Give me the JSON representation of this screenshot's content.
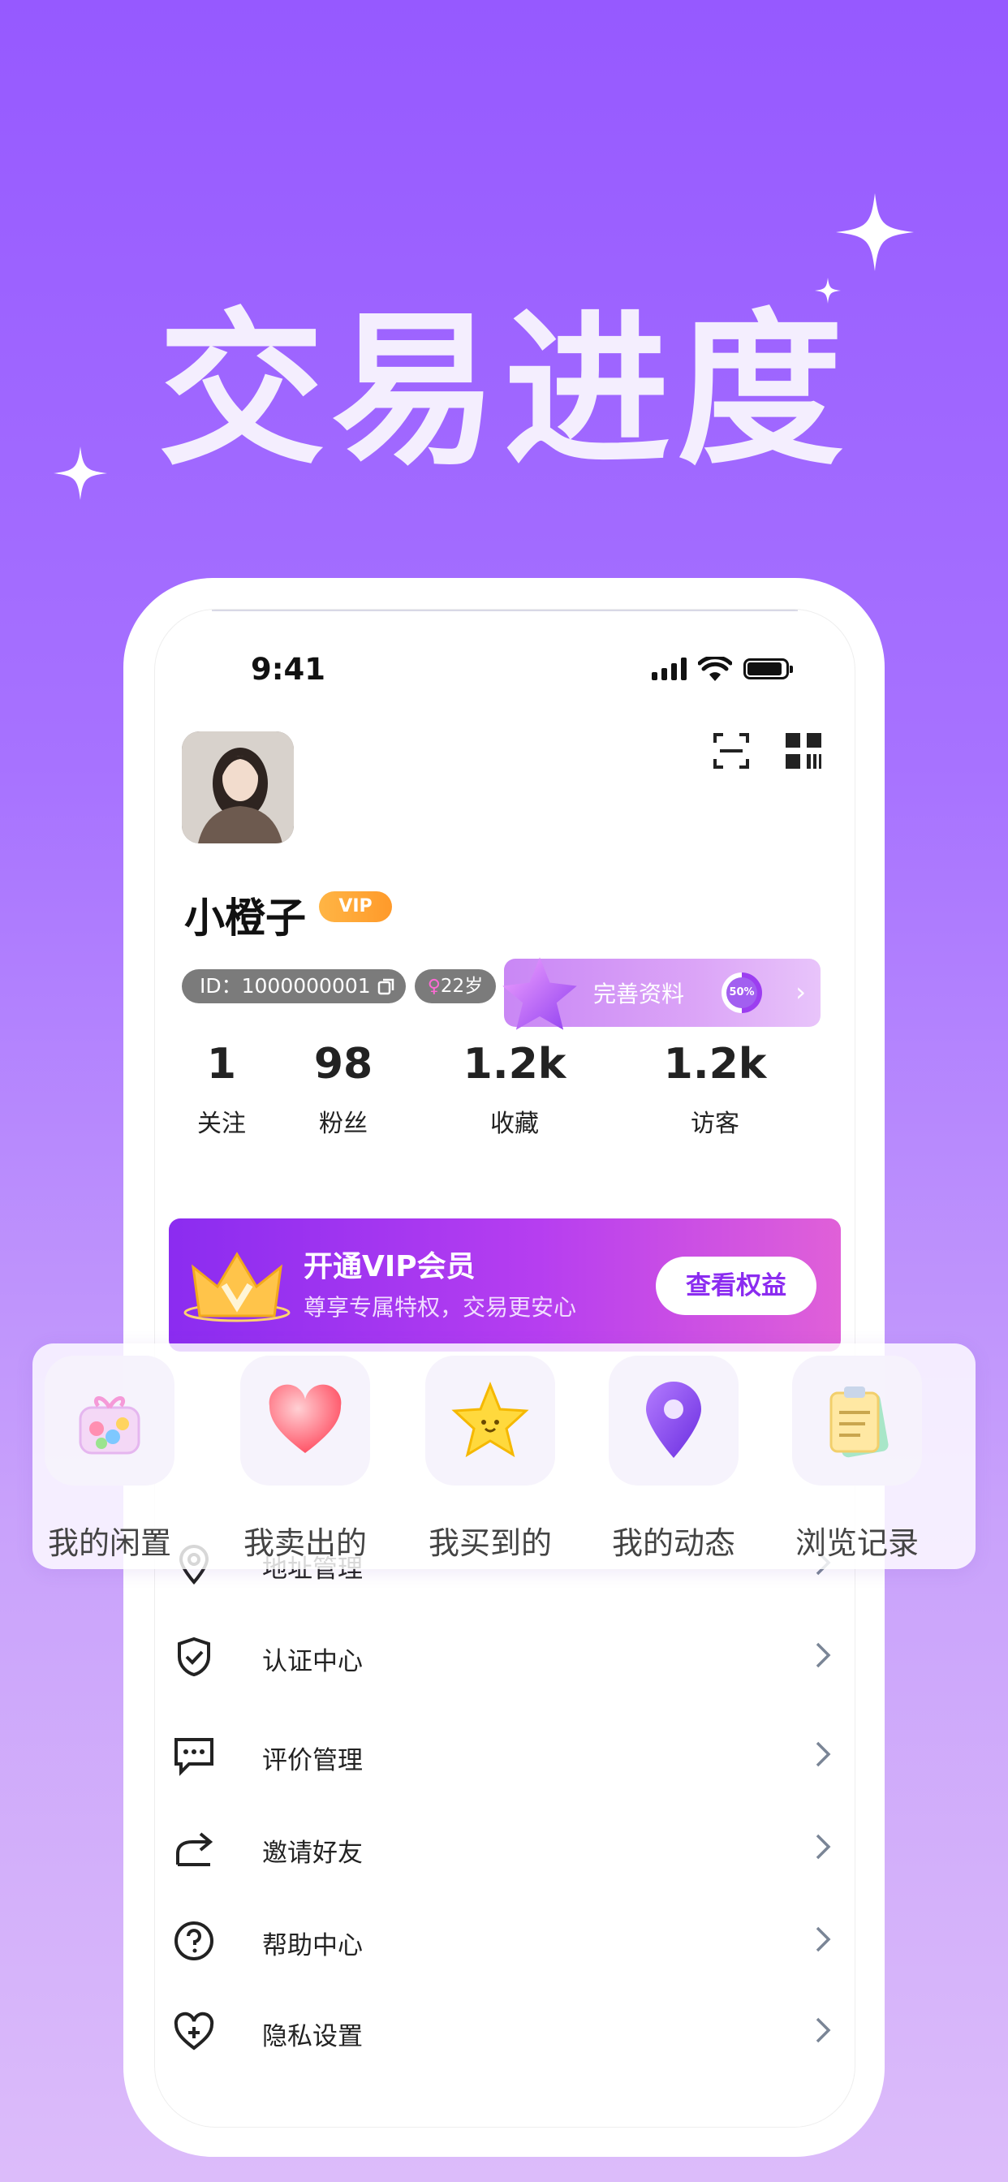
{
  "headline": "交易进度",
  "status_bar": {
    "time": "9:41"
  },
  "profile": {
    "name": "小橙子",
    "vip_badge": "VIP",
    "id_text": "ID：1000000001",
    "age_text": "22岁",
    "complete_profile_label": "完善资料",
    "complete_progress_text": "50%",
    "complete_progress_value": 0.5
  },
  "stats": [
    {
      "value": "1",
      "label": "关注"
    },
    {
      "value": "98",
      "label": "粉丝"
    },
    {
      "value": "1.2k",
      "label": "收藏"
    },
    {
      "value": "1.2k",
      "label": "访客"
    }
  ],
  "vip_banner": {
    "title": "开通VIP会员",
    "subtitle": "尊享专属特权，交易更安心",
    "button": "查看权益"
  },
  "tools": [
    {
      "label": "我的闲置",
      "icon": "gift-box-icon"
    },
    {
      "label": "我卖出的",
      "icon": "heart-icon"
    },
    {
      "label": "我买到的",
      "icon": "star-icon"
    },
    {
      "label": "我的动态",
      "icon": "location-pin-icon"
    },
    {
      "label": "浏览记录",
      "icon": "clipboard-icon"
    }
  ],
  "menu": [
    {
      "label": "地址管理",
      "icon": "location-icon"
    },
    {
      "label": "认证中心",
      "icon": "shield-check-icon"
    },
    {
      "label": "评价管理",
      "icon": "comment-icon"
    },
    {
      "label": "邀请好友",
      "icon": "share-icon"
    },
    {
      "label": "帮助中心",
      "icon": "help-icon"
    },
    {
      "label": "隐私设置",
      "icon": "heart-plus-icon"
    }
  ],
  "colors": {
    "background_top": "#9659ff",
    "background_bottom": "#dcbcfa",
    "vip_banner_start": "#8b2cf0",
    "vip_banner_end": "#e060d8",
    "vip_badge": "#ffa536"
  }
}
